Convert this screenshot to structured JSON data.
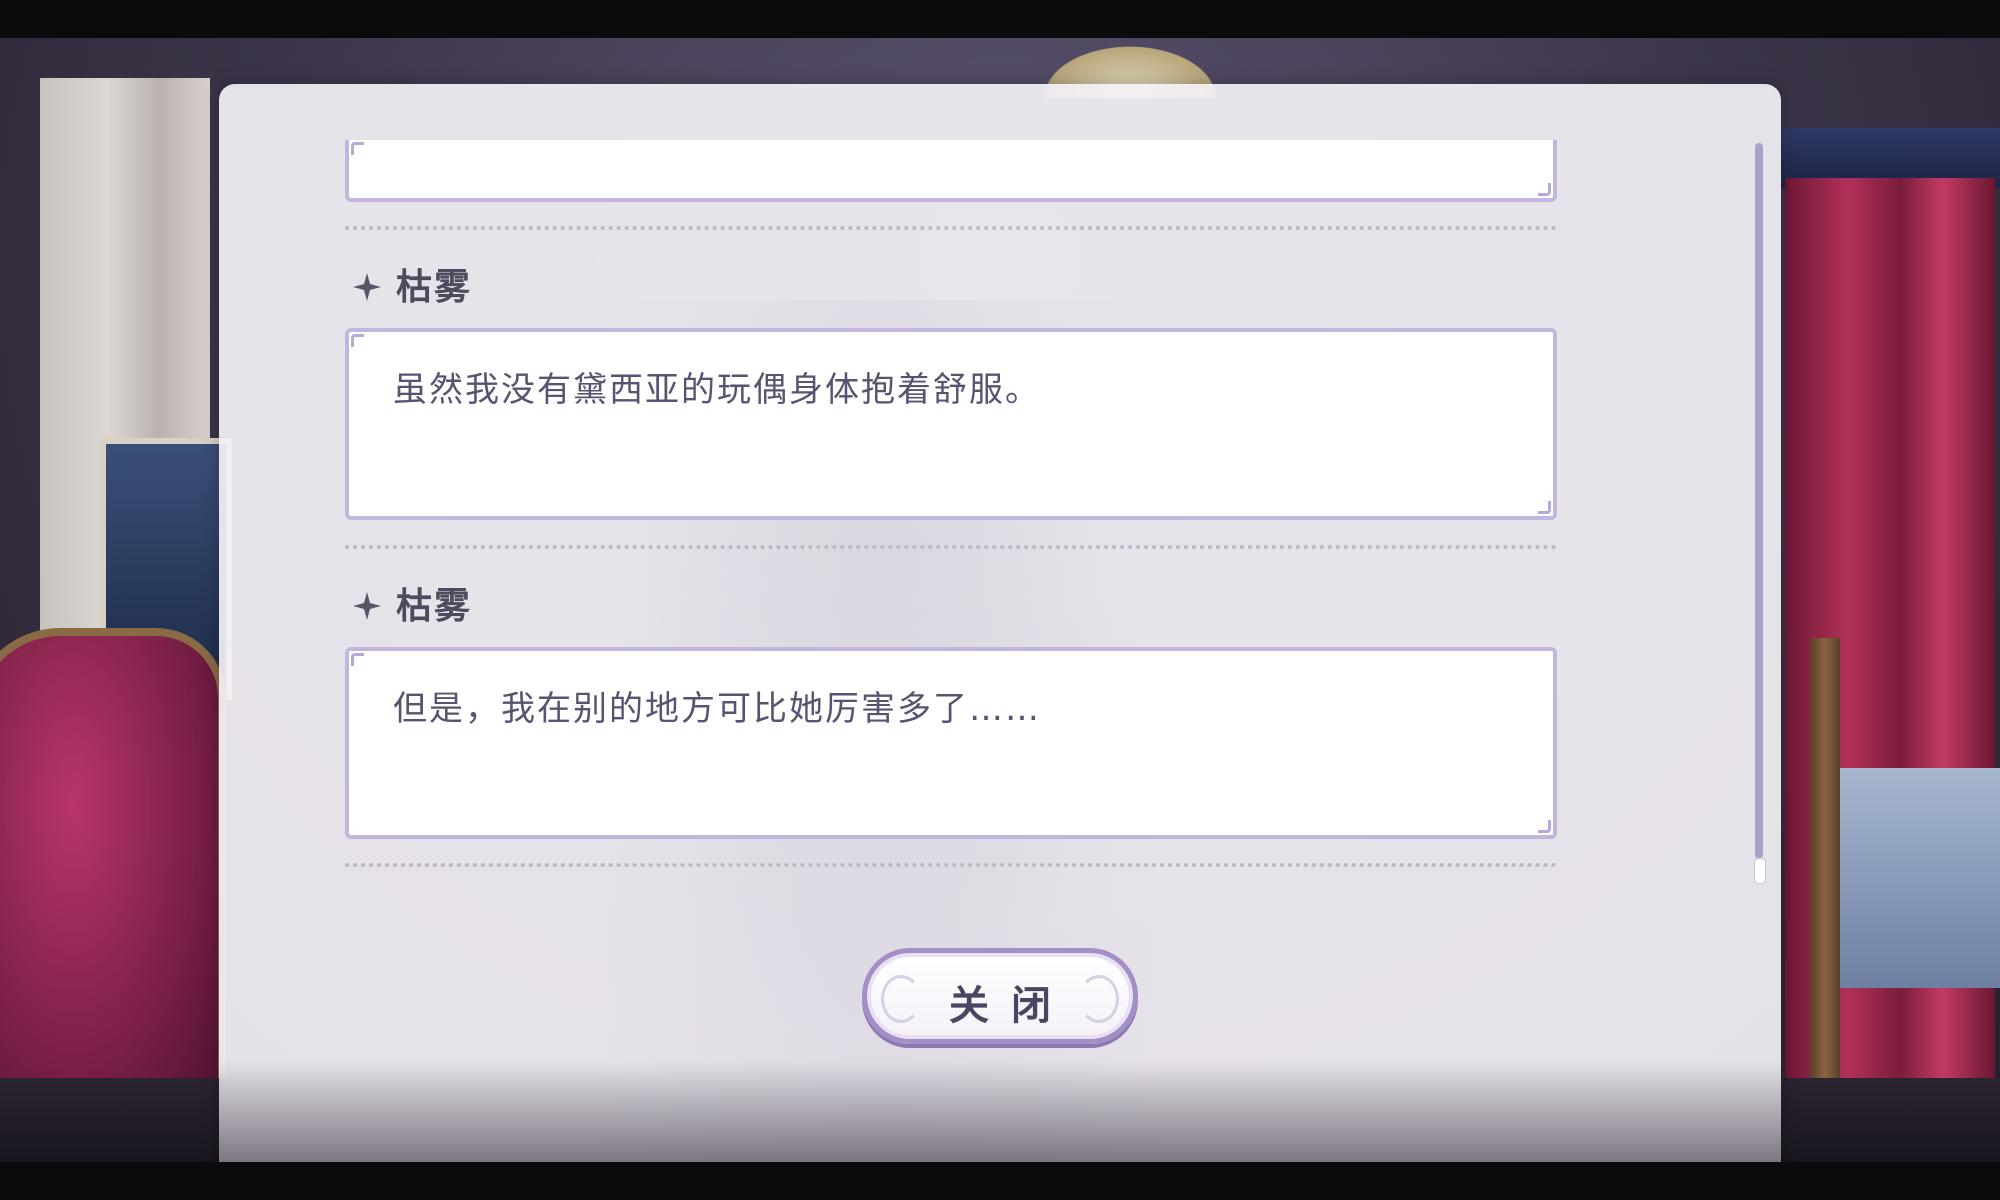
{
  "dialog_log": {
    "entries": [
      {
        "speaker": "",
        "text": ""
      },
      {
        "speaker": "枯雾",
        "text": "虽然我没有黛西亚的玩偶身体抱着舒服。"
      },
      {
        "speaker": "枯雾",
        "text": "但是，我在别的地方可比她厉害多了……"
      }
    ],
    "close_label": "关闭"
  },
  "colors": {
    "panel_bg": "#f3f0f5",
    "box_border": "#c3b6de",
    "text": "#5a5270",
    "speaker": "#4f4a5e",
    "button_border": "#a48ec6",
    "scrollbar": "#a8a2c8"
  },
  "icons": {
    "speaker_marker": "sparkle-icon"
  }
}
